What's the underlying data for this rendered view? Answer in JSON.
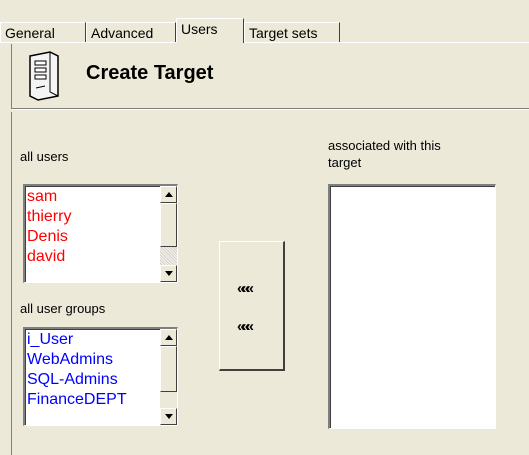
{
  "tabs": [
    {
      "label": "General"
    },
    {
      "label": "Advanced"
    },
    {
      "label": "Users"
    },
    {
      "label": "Target sets"
    }
  ],
  "active_tab": "Users",
  "header": {
    "title": "Create Target",
    "icon": "server-icon"
  },
  "all_users": {
    "label": "all users",
    "items": [
      "sam",
      "thierry",
      "Denis",
      "david"
    ],
    "item_color": "#ff0000"
  },
  "all_user_groups": {
    "label": "all user groups",
    "items": [
      "i_User",
      "WebAdmins",
      "SQL-Admins",
      "FinanceDEPT"
    ],
    "item_color": "#0000ff"
  },
  "buttons": {
    "add_users_glyph": "«««",
    "add_groups_glyph": "«««"
  },
  "associated": {
    "label_line1": "associated with this",
    "label_line2": "target",
    "items": []
  }
}
